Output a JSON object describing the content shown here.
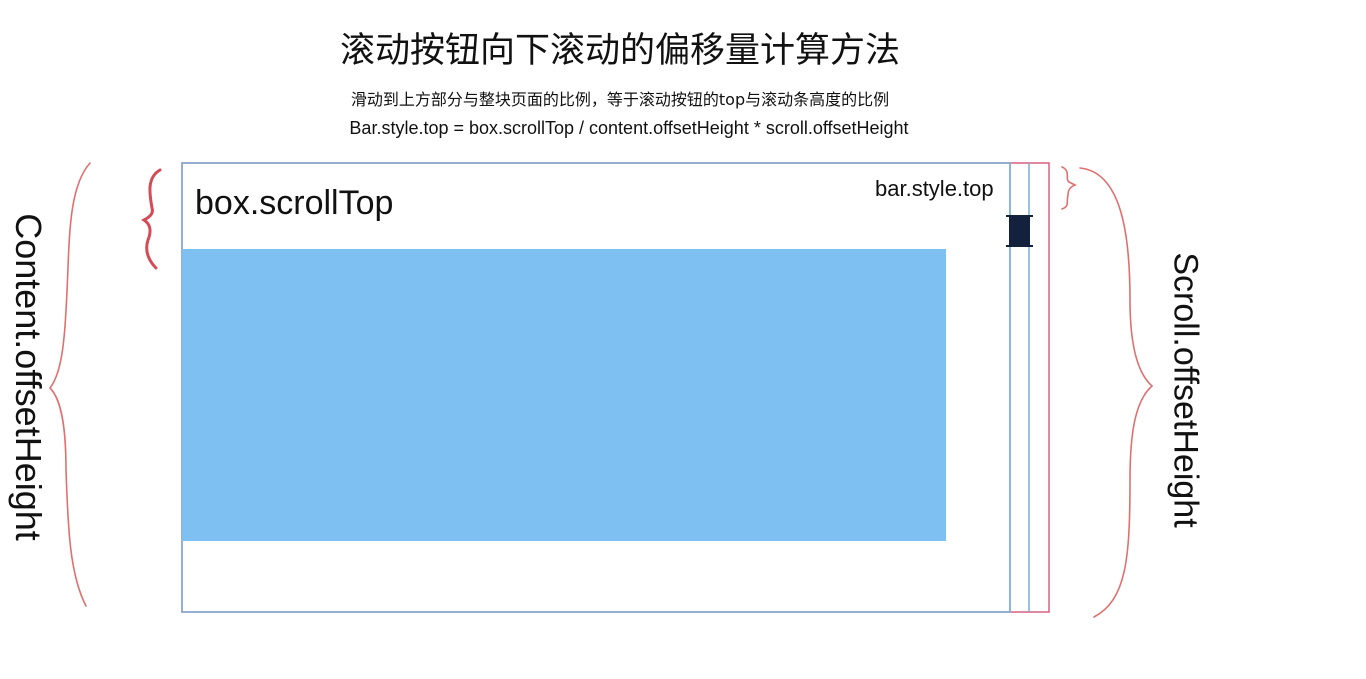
{
  "diagram": {
    "title": "滚动按钮向下滚动的偏移量计算方法",
    "subtitle": "滑动到上方部分与整块页面的比例，等于滚动按钮的top与滚动条高度的比例",
    "formula": "Bar.style.top = box.scrollTop / content.offsetHeight * scroll.offsetHeight",
    "labels": {
      "box_scroll_top": "box.scrollTop",
      "bar_style_top": "bar.style.top",
      "content_offset_height": "Content.offsetHeight",
      "scroll_offset_height": "Scroll.offsetHeight"
    },
    "colors": {
      "box_border": "#7aaed6",
      "scroll_border": "#d9607f",
      "content_fill": "#7fc0f2",
      "bar_fill": "#14213d",
      "brace": "#e07070",
      "brace_strong": "#d64b55"
    }
  }
}
